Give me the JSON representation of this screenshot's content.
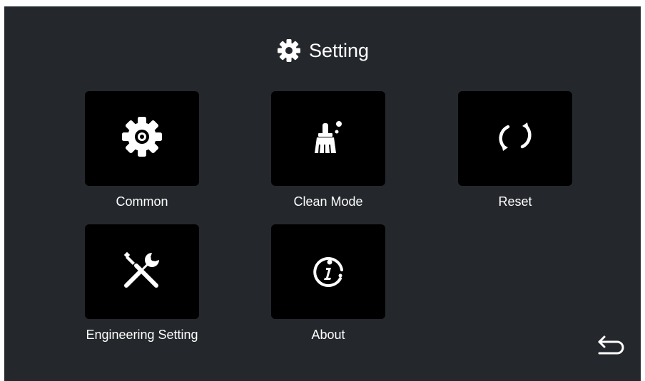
{
  "header": {
    "title": "Setting",
    "icon": "gear-icon"
  },
  "tiles": [
    {
      "label": "Common",
      "icon": "gear-icon"
    },
    {
      "label": "Clean Mode",
      "icon": "broom-icon"
    },
    {
      "label": "Reset",
      "icon": "refresh-icon"
    },
    {
      "label": "Engineering Setting",
      "icon": "tools-icon"
    },
    {
      "label": "About",
      "icon": "info-icon"
    }
  ],
  "footer": {
    "back_icon": "back-arrow-icon"
  },
  "colors": {
    "background": "#24272c",
    "tile": "#000000",
    "text": "#ffffff"
  }
}
